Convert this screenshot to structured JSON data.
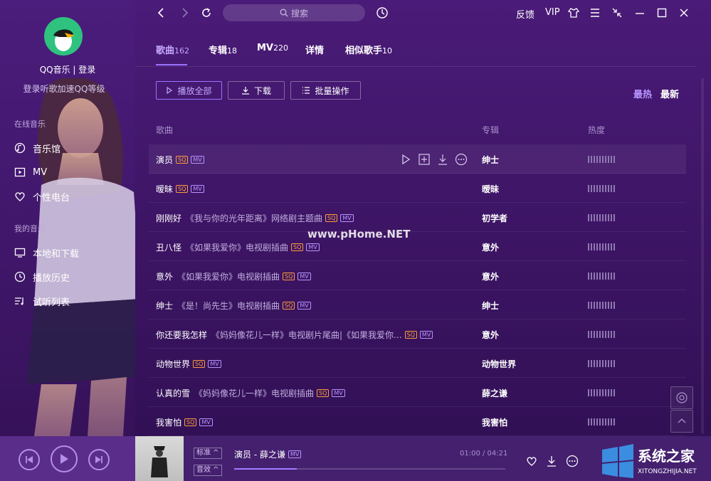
{
  "sidebar": {
    "login": "QQ音乐 | 登录",
    "login_hint": "登录听歌加速QQ等级",
    "section_online": "在线音乐",
    "section_mine": "我的音乐",
    "online_items": [
      {
        "label": "音乐馆",
        "icon": "music-hall-icon"
      },
      {
        "label": "MV",
        "icon": "mv-icon"
      },
      {
        "label": "个性电台",
        "icon": "radio-heart-icon"
      }
    ],
    "mine_items": [
      {
        "label": "本地和下载",
        "icon": "monitor-icon"
      },
      {
        "label": "播放历史",
        "icon": "clock-icon"
      },
      {
        "label": "试听列表",
        "icon": "playlist-icon"
      }
    ]
  },
  "topbar": {
    "search_placeholder": "搜索",
    "feedback": "反馈",
    "vip": "VIP"
  },
  "tabs": [
    {
      "label": "歌曲",
      "count": "162",
      "active": true
    },
    {
      "label": "专辑",
      "count": "18"
    },
    {
      "label": "MV",
      "count": "220"
    },
    {
      "label": "详情",
      "count": ""
    },
    {
      "label": "相似歌手",
      "count": "10"
    }
  ],
  "actions": {
    "play_all": "播放全部",
    "download": "下载",
    "batch": "批量操作",
    "sort_hot": "最热",
    "sort_new": "最新"
  },
  "table": {
    "headers": {
      "song": "歌曲",
      "album": "专辑",
      "heat": "热度"
    },
    "rows": [
      {
        "title": "演员",
        "subtitle": "",
        "album": "绅士",
        "heat": 10
      },
      {
        "title": "暧昧",
        "subtitle": "",
        "album": "暧昧",
        "heat": 10
      },
      {
        "title": "刚刚好",
        "subtitle": "《我与你的光年距离》网络剧主题曲",
        "album": "初学者",
        "heat": 10
      },
      {
        "title": "丑八怪",
        "subtitle": "《如果我爱你》电视剧插曲",
        "album": "意外",
        "heat": 10
      },
      {
        "title": "意外",
        "subtitle": "《如果我爱你》电视剧插曲",
        "album": "意外",
        "heat": 10
      },
      {
        "title": "绅士",
        "subtitle": "《是！尚先生》电视剧插曲",
        "album": "绅士",
        "heat": 10
      },
      {
        "title": "你还要我怎样",
        "subtitle": "《妈妈像花儿一样》电视剧片尾曲|《如果我爱你...",
        "album": "意外",
        "heat": 10
      },
      {
        "title": "动物世界",
        "subtitle": "",
        "album": "动物世界",
        "heat": 10
      },
      {
        "title": "认真的雪",
        "subtitle": "《妈妈像花儿一样》电视剧插曲",
        "album": "薛之谦",
        "heat": 10
      },
      {
        "title": "我害怕",
        "subtitle": "",
        "album": "我害怕",
        "heat": 10
      }
    ],
    "tag_sq": "SQ",
    "tag_mv": "MV"
  },
  "watermark": "www.pHome.NET",
  "player": {
    "quality": "标准",
    "effect": "音效",
    "song": "演员 - 薛之谦",
    "time": "01:00 / 04:21",
    "progress": 0.23
  },
  "logo": {
    "name": "系统之家",
    "url": "XITONGZHIJIA.NET"
  },
  "colors": {
    "accent": "#9b73ff",
    "sq": "#ff9d3b",
    "mv": "#b896ff"
  }
}
